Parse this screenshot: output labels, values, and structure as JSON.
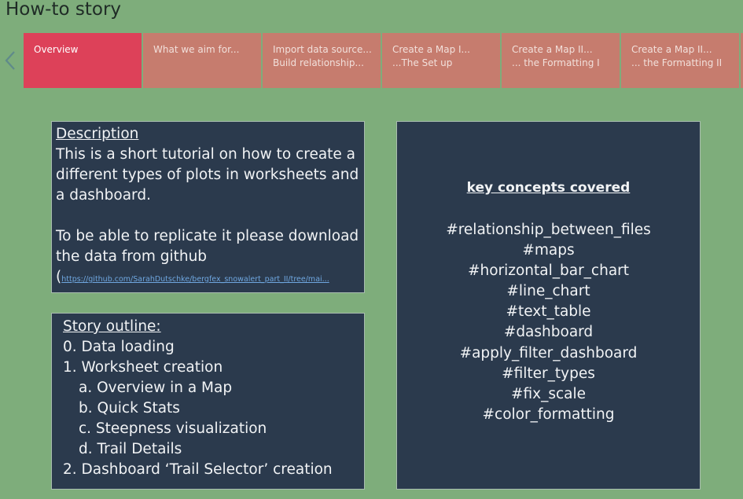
{
  "story": {
    "title": "How-to story"
  },
  "nav": {
    "prev_icon": "chevron-left-icon"
  },
  "tabs": [
    {
      "line1": "Overview",
      "line2": "",
      "active": true
    },
    {
      "line1": "What we aim for...",
      "line2": "",
      "active": false
    },
    {
      "line1": "Import data source...",
      "line2": "Build relationship...",
      "active": false
    },
    {
      "line1": "Create a Map I...",
      "line2": "...The Set up",
      "active": false
    },
    {
      "line1": "Create a Map II...",
      "line2": "... the Formatting I",
      "active": false
    },
    {
      "line1": "Create a Map II...",
      "line2": "... the Formatting II",
      "active": false
    }
  ],
  "description": {
    "heading": "Description",
    "para1": "This is a short tutorial on how to create a different types of plots in worksheets and a dashboard.",
    "para2": "To be able to replicate it please download the data from github",
    "link_prefix": "(",
    "link": "https://github.com/SarahDutschke/bergfex_snowalert_part_II/tree/mai..."
  },
  "outline": {
    "heading": "Story outline:",
    "items": [
      {
        "text": "0. Data loading",
        "indent": false
      },
      {
        "text": "1. Worksheet creation",
        "indent": false
      },
      {
        "text": "a. Overview in a Map",
        "indent": true
      },
      {
        "text": "b. Quick Stats",
        "indent": true
      },
      {
        "text": "c. Steepness visualization",
        "indent": true
      },
      {
        "text": "d. Trail Details",
        "indent": true
      },
      {
        "text": "2. Dashboard ‘Trail Selector’ creation",
        "indent": false
      }
    ]
  },
  "concepts": {
    "heading": "key concepts covered",
    "items": [
      "#relationship_between_files",
      "#maps",
      "#horizontal_bar_chart",
      "#line_chart",
      "#text_table",
      "#dashboard",
      "#apply_filter_dashboard",
      "#filter_types",
      "#fix_scale",
      "#color_formatting"
    ]
  },
  "colors": {
    "background": "#7ead7b",
    "tab_active": "#dd4159",
    "tab_inactive": "#c67c6e",
    "panel": "#2b3a4d",
    "link": "#6fa7e0"
  }
}
